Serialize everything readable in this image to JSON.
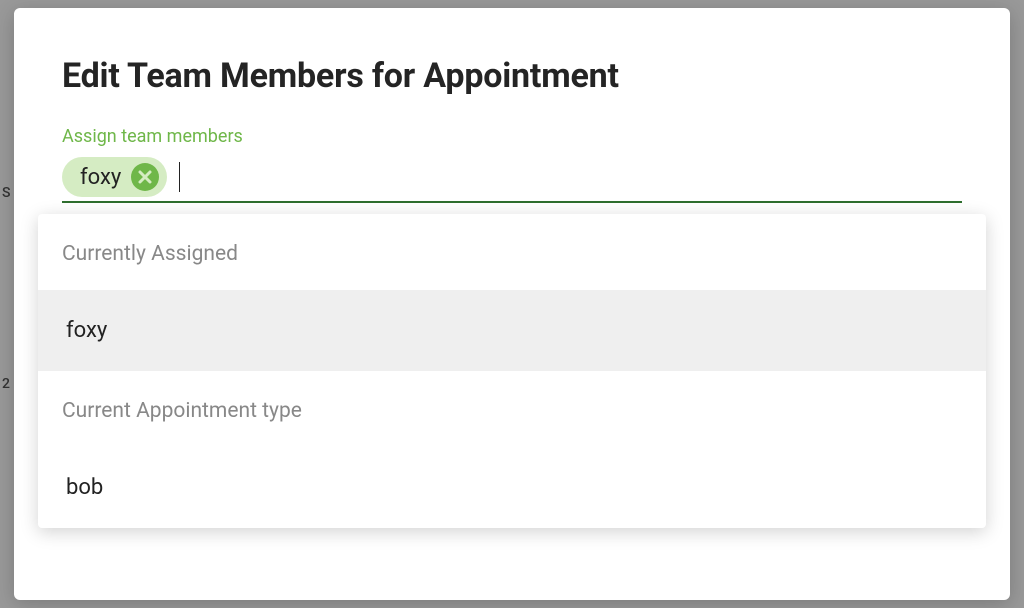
{
  "modal": {
    "title": "Edit Team Members for Appointment",
    "field_label": "Assign team members",
    "selected_chips": [
      {
        "label": "foxy"
      }
    ]
  },
  "dropdown": {
    "groups": [
      {
        "header": "Currently Assigned",
        "options": [
          {
            "label": "foxy",
            "highlighted": true
          }
        ]
      },
      {
        "header": "Current Appointment type",
        "options": [
          {
            "label": "bob",
            "highlighted": false
          }
        ]
      }
    ]
  },
  "background_peek": {
    "letter_s": "S",
    "number_2": "2"
  },
  "colors": {
    "accent_green": "#6fb749",
    "chip_bg": "#d5ecc3",
    "underline": "#2f6f2f",
    "button_green": "#6fc04d"
  }
}
